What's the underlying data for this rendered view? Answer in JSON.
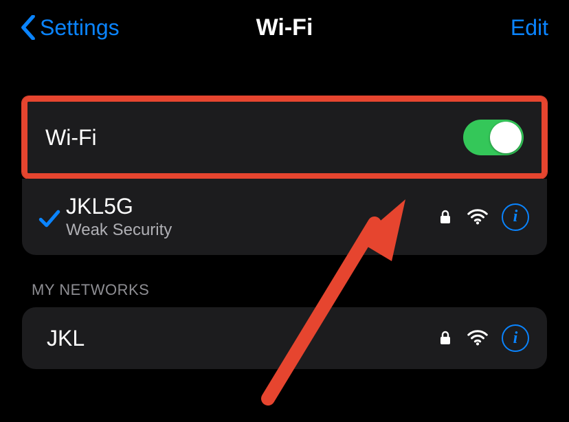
{
  "nav": {
    "back_label": "Settings",
    "title": "Wi-Fi",
    "edit_label": "Edit"
  },
  "wifi_toggle": {
    "label": "Wi-Fi",
    "on": true
  },
  "connected": {
    "name": "JKL5G",
    "status": "Weak Security"
  },
  "sections": {
    "my_networks_header": "MY NETWORKS",
    "my_networks": [
      {
        "name": "JKL"
      }
    ]
  },
  "icons": {
    "info": "i"
  }
}
